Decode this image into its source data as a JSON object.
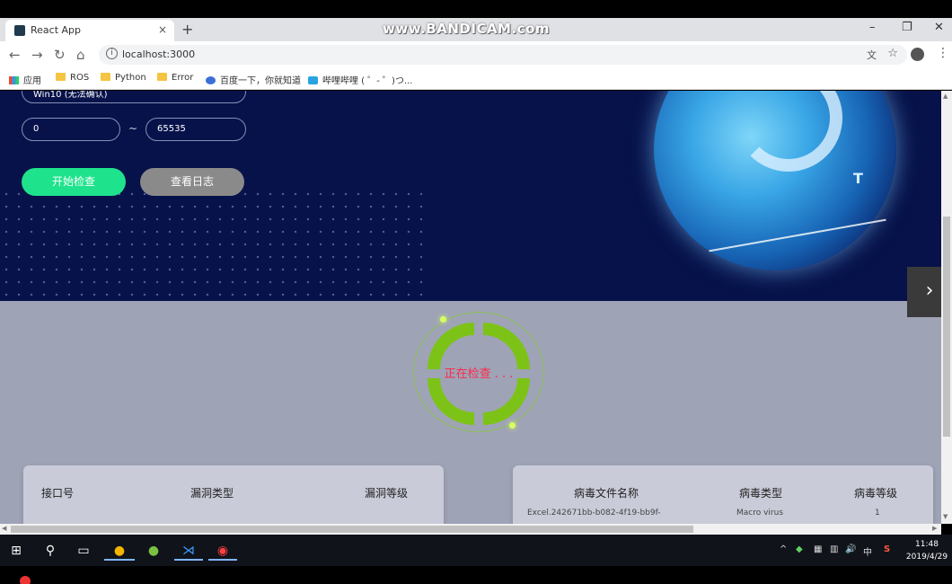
{
  "browser": {
    "watermark": "www.BANDICAM.com",
    "tab_title": "React App",
    "tab_close": "×",
    "new_tab": "+",
    "window_controls": {
      "minimize": "–",
      "restore": "❐",
      "close": "✕"
    },
    "nav": {
      "back": "←",
      "forward": "→",
      "reload": "↻",
      "home": "⌂"
    },
    "info_icon": "i",
    "url": "localhost:3000",
    "translate": "文",
    "star": "☆",
    "menu": "⋮"
  },
  "bookmarks": [
    {
      "label": "应用",
      "icon": "apps"
    },
    {
      "label": "ROS",
      "icon": "folder"
    },
    {
      "label": "Python",
      "icon": "folder"
    },
    {
      "label": "Error",
      "icon": "folder"
    },
    {
      "label": "百度一下，你就知道",
      "icon": "paw"
    },
    {
      "label": "哔哩哔哩 ( ゜- ゜)つ...",
      "icon": "tv"
    }
  ],
  "form": {
    "select_value": "Win10 (无法确认)",
    "port_start": "0",
    "tilde": "~",
    "port_end": "65535",
    "start_button": "开始检查",
    "log_button": "查看日志"
  },
  "globe": {
    "letter": "T"
  },
  "next_arrow": "›",
  "spinner": {
    "label": "正在检查 . . ."
  },
  "ports_table": {
    "headers": [
      "接口号",
      "漏洞类型",
      "漏洞等级"
    ]
  },
  "virus_table": {
    "headers": [
      "病毒文件名称",
      "病毒类型",
      "病毒等级"
    ],
    "rows": [
      {
        "name": "Excel.242671bb-b082-4f19-bb9f-",
        "type": "Macro virus",
        "level": "1"
      }
    ]
  },
  "scrollbar": {
    "up": "▲",
    "down": "▼",
    "left": "◀",
    "right": "▶"
  },
  "taskbar": {
    "start": "⊞",
    "search": "⚲",
    "taskview": "▭",
    "apps": [
      "●",
      "●",
      "⋊",
      "◉"
    ],
    "tray": [
      "^",
      "◆",
      "▦",
      "▥",
      "🔊",
      "中",
      "S"
    ],
    "time": "11:48",
    "date": "2019/4/29"
  },
  "colors": {
    "hero_bg": "#07124a",
    "start_button": "#1ee38c",
    "log_button": "#8a8a8a",
    "spinner": "#7dc317",
    "spinner_label": "#ff2a4a"
  }
}
